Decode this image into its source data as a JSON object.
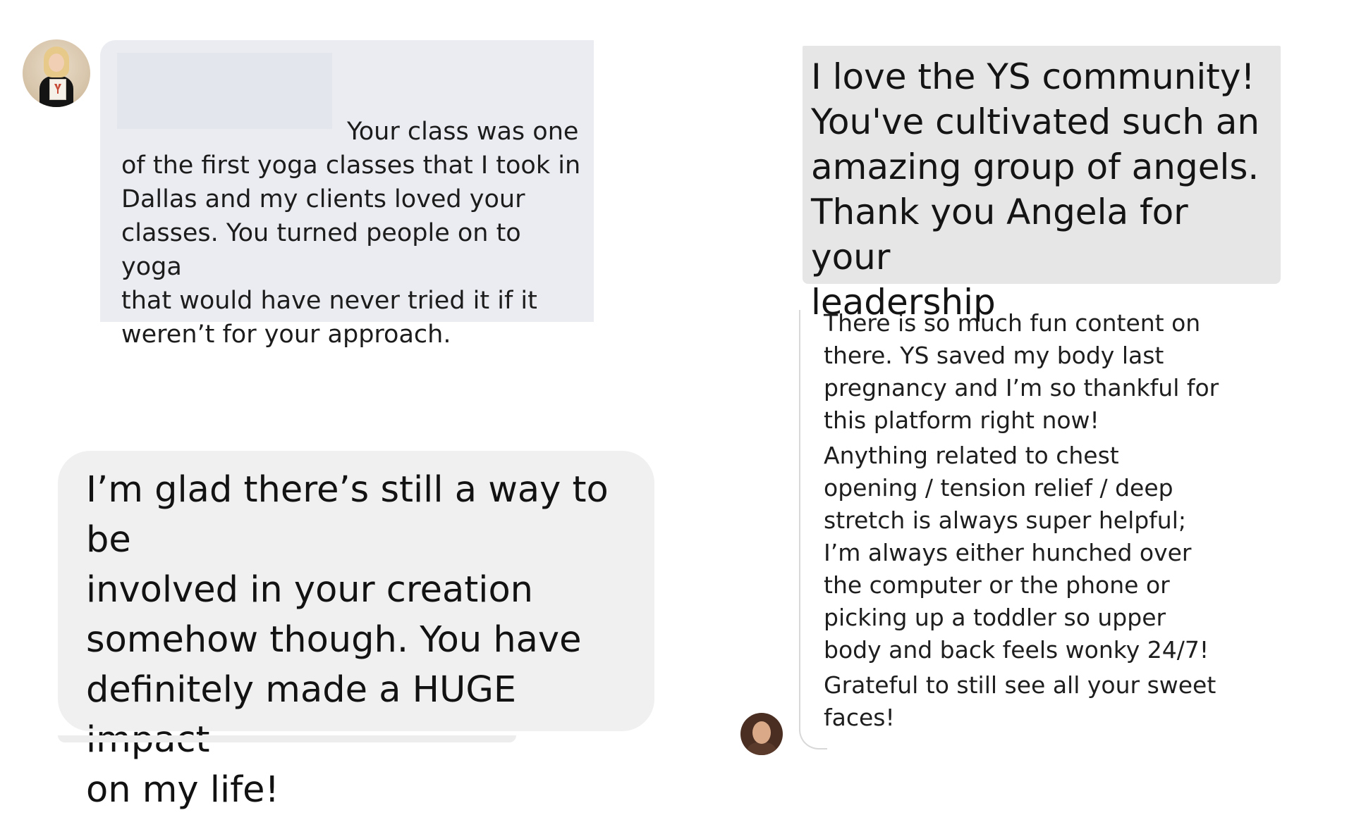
{
  "messages": {
    "top_left": {
      "text_lines": [
        "Your class was one",
        "of the first yoga  classes that I took in",
        "Dallas and my clients loved your",
        "classes. You turned people on to yoga",
        "that would have never tried it if it",
        "weren’t for your approach."
      ]
    },
    "top_right": {
      "text_lines": [
        "I love the YS community!",
        "You've cultivated such an",
        "amazing group of angels.",
        "Thank you Angela for your",
        "leadership"
      ]
    },
    "bottom_left": {
      "text_lines": [
        "I’m glad there’s still a way to be",
        "involved in your creation",
        "somehow though. You have",
        "definitely made a HUGE impact",
        "on my life!"
      ]
    },
    "thread_right": {
      "paragraphs": [
        {
          "lines": [
            "There is so much fun content on",
            "there. YS saved my body last",
            "pregnancy and I’m so thankful for",
            "this platform right now!"
          ]
        },
        {
          "lines": [
            "Anything related to chest",
            "opening / tension relief / deep",
            "stretch is always super helpful;",
            "I’m always either hunched over",
            "the computer or the phone or",
            "picking up a toddler so upper",
            "body and back feels wonky 24/7!"
          ]
        },
        {
          "lines": [
            "Grateful to still see all your sweet",
            "faces!"
          ]
        }
      ]
    }
  },
  "colors": {
    "bubble_light_blue_gray": "#eaecf1",
    "bubble_gray": "#e6e6e6",
    "bubble_light_gray": "#f0f0f0",
    "thread_line": "#d8d8d8",
    "background": "#ffffff"
  },
  "icons": {
    "avatar_1": "user-avatar-photo",
    "avatar_2": "user-avatar-photo"
  }
}
